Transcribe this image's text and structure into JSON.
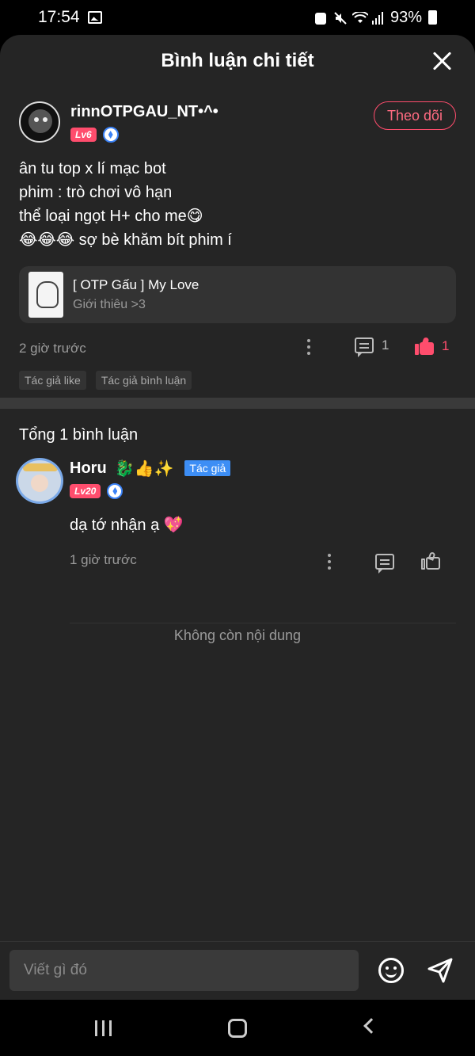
{
  "status_bar": {
    "time": "17:54",
    "battery": "93%"
  },
  "header": {
    "title": "Bình luận chi tiết"
  },
  "post": {
    "author_name": "rinnOTPGAU_NT•^•",
    "level": "Lv6",
    "follow_label": "Theo dõi",
    "body_lines": [
      "ân tu top x lí mạc bot",
      "phim : trò chơi vô hạn",
      "thể loại ngọt H+ cho me😋",
      "😂😂😂 sợ bè khăm bít phim í"
    ],
    "book": {
      "title": "[ OTP Gấu ] My Love",
      "subtitle": "Giới thiêu >3"
    },
    "time_ago": "2 giờ trước",
    "comment_count": "1",
    "like_count": "1",
    "tags": [
      "Tác giả like",
      "Tác giả bình luận"
    ]
  },
  "comments_section": {
    "title": "Tổng 1 bình luận",
    "items": [
      {
        "name": "Horu",
        "name_emojis": "🐉👍✨",
        "author_tag": "Tác giả",
        "level": "Lv20",
        "text": "dạ tớ nhận ạ 💖",
        "time_ago": "1 giờ trước"
      }
    ],
    "end_text": "Không còn nội dung"
  },
  "input": {
    "placeholder": "Viết gì đó"
  },
  "colors": {
    "accent": "#ff4d6d",
    "author_tag": "#3d8ef5",
    "background": "#252525"
  }
}
